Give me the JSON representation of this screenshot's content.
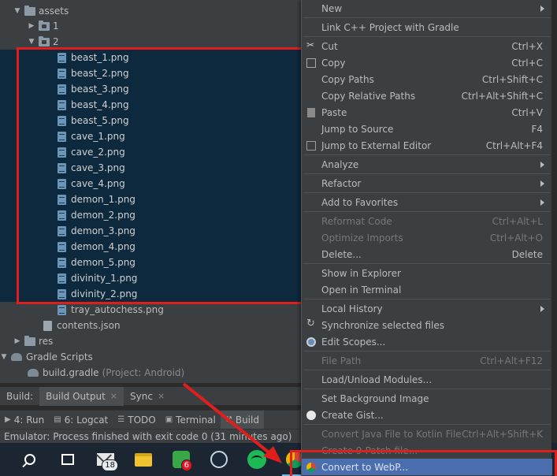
{
  "tree": {
    "assets": "assets",
    "folder_1": "1",
    "folder_2": "2",
    "files": [
      "beast_1.png",
      "beast_2.png",
      "beast_3.png",
      "beast_4.png",
      "beast_5.png",
      "cave_1.png",
      "cave_2.png",
      "cave_3.png",
      "cave_4.png",
      "demon_1.png",
      "demon_2.png",
      "demon_3.png",
      "demon_4.png",
      "demon_5.png",
      "divinity_1.png",
      "divinity_2.png"
    ],
    "tray": "tray_autochess.png",
    "contents": "contents.json",
    "res": "res",
    "gradle_scripts": "Gradle Scripts",
    "build_gradle": "build.gradle",
    "build_gradle_hint": "(Project: Android)"
  },
  "build_tabs": {
    "build": "Build:",
    "build_output": "Build Output",
    "sync": "Sync",
    "close": "×"
  },
  "tool_strip": {
    "run": "4: Run",
    "logcat": "6: Logcat",
    "todo": "TODO",
    "terminal": "Terminal",
    "build": "Build"
  },
  "status": "Emulator: Process finished with exit code 0 (31 minutes ago)",
  "taskbar": {
    "mail_badge": "18",
    "green_badge": "6"
  },
  "menu": {
    "new": "New",
    "link_cpp": "Link C++ Project with Gradle",
    "cut": "Cut",
    "cut_sc": "Ctrl+X",
    "copy": "Copy",
    "copy_sc": "Ctrl+C",
    "copy_paths": "Copy Paths",
    "copy_paths_sc": "Ctrl+Shift+C",
    "copy_rel": "Copy Relative Paths",
    "copy_rel_sc": "Ctrl+Alt+Shift+C",
    "paste": "Paste",
    "paste_sc": "Ctrl+V",
    "jump_source": "Jump to Source",
    "jump_source_sc": "F4",
    "jump_ext": "Jump to External Editor",
    "jump_ext_sc": "Ctrl+Alt+F4",
    "analyze": "Analyze",
    "refactor": "Refactor",
    "favorites": "Add to Favorites",
    "reformat": "Reformat Code",
    "reformat_sc": "Ctrl+Alt+L",
    "optimize": "Optimize Imports",
    "optimize_sc": "Ctrl+Alt+O",
    "delete": "Delete...",
    "delete_sc": "Delete",
    "show_explorer": "Show in Explorer",
    "open_terminal": "Open in Terminal",
    "local_history": "Local History",
    "sync": "Synchronize selected files",
    "edit_scopes": "Edit Scopes...",
    "file_path": "File Path",
    "file_path_sc": "Ctrl+Alt+F12",
    "load_unload": "Load/Unload Modules...",
    "set_bg": "Set Background Image",
    "create_gist": "Create Gist...",
    "convert_kotlin": "Convert Java File to Kotlin File",
    "convert_kotlin_sc": "Ctrl+Alt+Shift+K",
    "create_patch": "Create 9-Patch file...",
    "convert_webp": "Convert to WebP..."
  }
}
